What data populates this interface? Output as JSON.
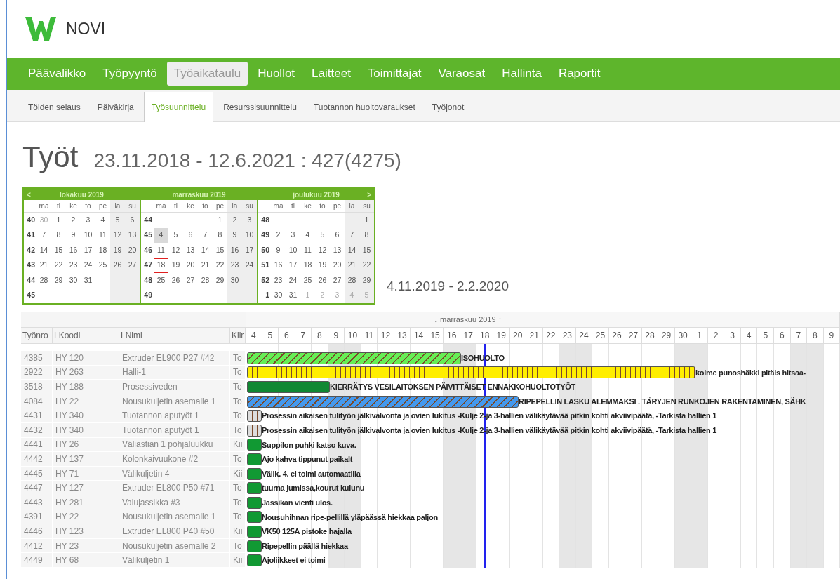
{
  "header": {
    "logo_text": "NOVI"
  },
  "main_nav": [
    {
      "label": "Päävalikko",
      "selected": false
    },
    {
      "label": "Työpyyntö",
      "selected": false
    },
    {
      "label": "Työaikataulu",
      "selected": true
    },
    {
      "label": "Huollot",
      "selected": false
    },
    {
      "label": "Laitteet",
      "selected": false
    },
    {
      "label": "Toimittajat",
      "selected": false
    },
    {
      "label": "Varaosat",
      "selected": false
    },
    {
      "label": "Hallinta",
      "selected": false
    },
    {
      "label": "Raportit",
      "selected": false
    }
  ],
  "sub_nav": [
    {
      "label": "Töiden selaus",
      "selected": false
    },
    {
      "label": "Päiväkirja",
      "selected": false
    },
    {
      "label": "Työsuunnittelu",
      "selected": true
    },
    {
      "label": "Resurssisuunnittelu",
      "selected": false
    },
    {
      "label": "Tuotannon huoltovaraukset",
      "selected": false
    },
    {
      "label": "Työjonot",
      "selected": false
    }
  ],
  "page_title": {
    "title": "Työt",
    "range": "23.11.2018 - 12.6.2021 : 427(4275)"
  },
  "calendar": {
    "prev": "<",
    "next": ">",
    "months": [
      {
        "title": "lokakuu 2019",
        "weekdays": [
          "ma",
          "ti",
          "ke",
          "to",
          "pe",
          "la",
          "su"
        ],
        "weeks": [
          {
            "week": "40",
            "days": [
              {
                "kind": "day",
                "t": "30",
                "muted": true,
                "selected": false,
                "today": false
              },
              {
                "kind": "day",
                "t": "1",
                "muted": false,
                "selected": false,
                "today": false
              },
              {
                "kind": "day",
                "t": "2",
                "muted": false,
                "selected": false,
                "today": false
              },
              {
                "kind": "day",
                "t": "3",
                "muted": false,
                "selected": false,
                "today": false
              },
              {
                "kind": "day",
                "t": "4",
                "muted": false,
                "selected": false,
                "today": false
              },
              {
                "kind": "day",
                "t": "5",
                "muted": false,
                "selected": false,
                "today": false
              },
              {
                "kind": "day",
                "t": "6",
                "muted": false,
                "selected": false,
                "today": false
              }
            ]
          },
          {
            "week": "41",
            "days": [
              {
                "kind": "day",
                "t": "7",
                "muted": false,
                "selected": false,
                "today": false
              },
              {
                "kind": "day",
                "t": "8",
                "muted": false,
                "selected": false,
                "today": false
              },
              {
                "kind": "day",
                "t": "9",
                "muted": false,
                "selected": false,
                "today": false
              },
              {
                "kind": "day",
                "t": "10",
                "muted": false,
                "selected": false,
                "today": false
              },
              {
                "kind": "day",
                "t": "11",
                "muted": false,
                "selected": false,
                "today": false
              },
              {
                "kind": "day",
                "t": "12",
                "muted": false,
                "selected": false,
                "today": false
              },
              {
                "kind": "day",
                "t": "13",
                "muted": false,
                "selected": false,
                "today": false
              }
            ]
          },
          {
            "week": "42",
            "days": [
              {
                "kind": "day",
                "t": "14",
                "muted": false,
                "selected": false,
                "today": false
              },
              {
                "kind": "day",
                "t": "15",
                "muted": false,
                "selected": false,
                "today": false
              },
              {
                "kind": "day",
                "t": "16",
                "muted": false,
                "selected": false,
                "today": false
              },
              {
                "kind": "day",
                "t": "17",
                "muted": false,
                "selected": false,
                "today": false
              },
              {
                "kind": "day",
                "t": "18",
                "muted": false,
                "selected": false,
                "today": false
              },
              {
                "kind": "day",
                "t": "19",
                "muted": false,
                "selected": false,
                "today": false
              },
              {
                "kind": "day",
                "t": "20",
                "muted": false,
                "selected": false,
                "today": false
              }
            ]
          },
          {
            "week": "43",
            "days": [
              {
                "kind": "day",
                "t": "21",
                "muted": false,
                "selected": false,
                "today": false
              },
              {
                "kind": "day",
                "t": "22",
                "muted": false,
                "selected": false,
                "today": false
              },
              {
                "kind": "day",
                "t": "23",
                "muted": false,
                "selected": false,
                "today": false
              },
              {
                "kind": "day",
                "t": "24",
                "muted": false,
                "selected": false,
                "today": false
              },
              {
                "kind": "day",
                "t": "25",
                "muted": false,
                "selected": false,
                "today": false
              },
              {
                "kind": "day",
                "t": "26",
                "muted": false,
                "selected": false,
                "today": false
              },
              {
                "kind": "day",
                "t": "27",
                "muted": false,
                "selected": false,
                "today": false
              }
            ]
          },
          {
            "week": "44",
            "days": [
              {
                "kind": "day",
                "t": "28",
                "muted": false,
                "selected": false,
                "today": false
              },
              {
                "kind": "day",
                "t": "29",
                "muted": false,
                "selected": false,
                "today": false
              },
              {
                "kind": "day",
                "t": "30",
                "muted": false,
                "selected": false,
                "today": false
              },
              {
                "kind": "day",
                "t": "31",
                "muted": false,
                "selected": false,
                "today": false
              },
              {
                "kind": "blank"
              },
              {
                "kind": "blank"
              },
              {
                "kind": "blank"
              }
            ]
          },
          {
            "week": "45",
            "days": [
              {
                "kind": "blank"
              },
              {
                "kind": "blank"
              },
              {
                "kind": "blank"
              },
              {
                "kind": "blank"
              },
              {
                "kind": "blank"
              },
              {
                "kind": "blank"
              },
              {
                "kind": "blank"
              }
            ]
          }
        ]
      },
      {
        "title": "marraskuu 2019",
        "weekdays": [
          "ma",
          "ti",
          "ke",
          "to",
          "pe",
          "la",
          "su"
        ],
        "weeks": [
          {
            "week": "44",
            "days": [
              {
                "kind": "blank"
              },
              {
                "kind": "blank"
              },
              {
                "kind": "blank"
              },
              {
                "kind": "blank"
              },
              {
                "kind": "day",
                "t": "1",
                "muted": false,
                "selected": false,
                "today": false
              },
              {
                "kind": "day",
                "t": "2",
                "muted": false,
                "selected": false,
                "today": false
              },
              {
                "kind": "day",
                "t": "3",
                "muted": false,
                "selected": false,
                "today": false
              }
            ]
          },
          {
            "week": "45",
            "days": [
              {
                "kind": "day",
                "t": "4",
                "muted": false,
                "selected": true,
                "today": false
              },
              {
                "kind": "day",
                "t": "5",
                "muted": false,
                "selected": false,
                "today": false
              },
              {
                "kind": "day",
                "t": "6",
                "muted": false,
                "selected": false,
                "today": false
              },
              {
                "kind": "day",
                "t": "7",
                "muted": false,
                "selected": false,
                "today": false
              },
              {
                "kind": "day",
                "t": "8",
                "muted": false,
                "selected": false,
                "today": false
              },
              {
                "kind": "day",
                "t": "9",
                "muted": false,
                "selected": false,
                "today": false
              },
              {
                "kind": "day",
                "t": "10",
                "muted": false,
                "selected": false,
                "today": false
              }
            ]
          },
          {
            "week": "46",
            "days": [
              {
                "kind": "day",
                "t": "11",
                "muted": false,
                "selected": false,
                "today": false
              },
              {
                "kind": "day",
                "t": "12",
                "muted": false,
                "selected": false,
                "today": false
              },
              {
                "kind": "day",
                "t": "13",
                "muted": false,
                "selected": false,
                "today": false
              },
              {
                "kind": "day",
                "t": "14",
                "muted": false,
                "selected": false,
                "today": false
              },
              {
                "kind": "day",
                "t": "15",
                "muted": false,
                "selected": false,
                "today": false
              },
              {
                "kind": "day",
                "t": "16",
                "muted": false,
                "selected": false,
                "today": false
              },
              {
                "kind": "day",
                "t": "17",
                "muted": false,
                "selected": false,
                "today": false
              }
            ]
          },
          {
            "week": "47",
            "days": [
              {
                "kind": "day",
                "t": "18",
                "muted": false,
                "selected": false,
                "today": true
              },
              {
                "kind": "day",
                "t": "19",
                "muted": false,
                "selected": false,
                "today": false
              },
              {
                "kind": "day",
                "t": "20",
                "muted": false,
                "selected": false,
                "today": false
              },
              {
                "kind": "day",
                "t": "21",
                "muted": false,
                "selected": false,
                "today": false
              },
              {
                "kind": "day",
                "t": "22",
                "muted": false,
                "selected": false,
                "today": false
              },
              {
                "kind": "day",
                "t": "23",
                "muted": false,
                "selected": false,
                "today": false
              },
              {
                "kind": "day",
                "t": "24",
                "muted": false,
                "selected": false,
                "today": false
              }
            ]
          },
          {
            "week": "48",
            "days": [
              {
                "kind": "day",
                "t": "25",
                "muted": false,
                "selected": false,
                "today": false
              },
              {
                "kind": "day",
                "t": "26",
                "muted": false,
                "selected": false,
                "today": false
              },
              {
                "kind": "day",
                "t": "27",
                "muted": false,
                "selected": false,
                "today": false
              },
              {
                "kind": "day",
                "t": "28",
                "muted": false,
                "selected": false,
                "today": false
              },
              {
                "kind": "day",
                "t": "29",
                "muted": false,
                "selected": false,
                "today": false
              },
              {
                "kind": "day",
                "t": "30",
                "muted": false,
                "selected": false,
                "today": false
              },
              {
                "kind": "blank"
              }
            ]
          },
          {
            "week": "49",
            "days": [
              {
                "kind": "blank"
              },
              {
                "kind": "blank"
              },
              {
                "kind": "blank"
              },
              {
                "kind": "blank"
              },
              {
                "kind": "blank"
              },
              {
                "kind": "blank"
              },
              {
                "kind": "blank"
              }
            ]
          }
        ]
      },
      {
        "title": "joulukuu 2019",
        "weekdays": [
          "ma",
          "ti",
          "ke",
          "to",
          "pe",
          "la",
          "su"
        ],
        "weeks": [
          {
            "week": "48",
            "days": [
              {
                "kind": "blank"
              },
              {
                "kind": "blank"
              },
              {
                "kind": "blank"
              },
              {
                "kind": "blank"
              },
              {
                "kind": "blank"
              },
              {
                "kind": "blank"
              },
              {
                "kind": "day",
                "t": "1",
                "muted": false,
                "selected": false,
                "today": false
              }
            ]
          },
          {
            "week": "49",
            "days": [
              {
                "kind": "day",
                "t": "2",
                "muted": false,
                "selected": false,
                "today": false
              },
              {
                "kind": "day",
                "t": "3",
                "muted": false,
                "selected": false,
                "today": false
              },
              {
                "kind": "day",
                "t": "4",
                "muted": false,
                "selected": false,
                "today": false
              },
              {
                "kind": "day",
                "t": "5",
                "muted": false,
                "selected": false,
                "today": false
              },
              {
                "kind": "day",
                "t": "6",
                "muted": false,
                "selected": false,
                "today": false
              },
              {
                "kind": "day",
                "t": "7",
                "muted": false,
                "selected": false,
                "today": false
              },
              {
                "kind": "day",
                "t": "8",
                "muted": false,
                "selected": false,
                "today": false
              }
            ]
          },
          {
            "week": "50",
            "days": [
              {
                "kind": "day",
                "t": "9",
                "muted": false,
                "selected": false,
                "today": false
              },
              {
                "kind": "day",
                "t": "10",
                "muted": false,
                "selected": false,
                "today": false
              },
              {
                "kind": "day",
                "t": "11",
                "muted": false,
                "selected": false,
                "today": false
              },
              {
                "kind": "day",
                "t": "12",
                "muted": false,
                "selected": false,
                "today": false
              },
              {
                "kind": "day",
                "t": "13",
                "muted": false,
                "selected": false,
                "today": false
              },
              {
                "kind": "day",
                "t": "14",
                "muted": false,
                "selected": false,
                "today": false
              },
              {
                "kind": "day",
                "t": "15",
                "muted": false,
                "selected": false,
                "today": false
              }
            ]
          },
          {
            "week": "51",
            "days": [
              {
                "kind": "day",
                "t": "16",
                "muted": false,
                "selected": false,
                "today": false
              },
              {
                "kind": "day",
                "t": "17",
                "muted": false,
                "selected": false,
                "today": false
              },
              {
                "kind": "day",
                "t": "18",
                "muted": false,
                "selected": false,
                "today": false
              },
              {
                "kind": "day",
                "t": "19",
                "muted": false,
                "selected": false,
                "today": false
              },
              {
                "kind": "day",
                "t": "20",
                "muted": false,
                "selected": false,
                "today": false
              },
              {
                "kind": "day",
                "t": "21",
                "muted": false,
                "selected": false,
                "today": false
              },
              {
                "kind": "day",
                "t": "22",
                "muted": false,
                "selected": false,
                "today": false
              }
            ]
          },
          {
            "week": "52",
            "days": [
              {
                "kind": "day",
                "t": "23",
                "muted": false,
                "selected": false,
                "today": false
              },
              {
                "kind": "day",
                "t": "24",
                "muted": false,
                "selected": false,
                "today": false
              },
              {
                "kind": "day",
                "t": "25",
                "muted": false,
                "selected": false,
                "today": false
              },
              {
                "kind": "day",
                "t": "26",
                "muted": false,
                "selected": false,
                "today": false
              },
              {
                "kind": "day",
                "t": "27",
                "muted": false,
                "selected": false,
                "today": false
              },
              {
                "kind": "day",
                "t": "28",
                "muted": false,
                "selected": false,
                "today": false
              },
              {
                "kind": "day",
                "t": "29",
                "muted": false,
                "selected": false,
                "today": false
              }
            ]
          },
          {
            "week": "1",
            "days": [
              {
                "kind": "day",
                "t": "30",
                "muted": false,
                "selected": false,
                "today": false
              },
              {
                "kind": "day",
                "t": "31",
                "muted": false,
                "selected": false,
                "today": false
              },
              {
                "kind": "day",
                "t": "1",
                "muted": true,
                "selected": false,
                "today": false
              },
              {
                "kind": "day",
                "t": "2",
                "muted": true,
                "selected": false,
                "today": false
              },
              {
                "kind": "day",
                "t": "3",
                "muted": true,
                "selected": false,
                "today": false
              },
              {
                "kind": "day",
                "t": "4",
                "muted": true,
                "selected": false,
                "today": false
              },
              {
                "kind": "day",
                "t": "5",
                "muted": true,
                "selected": false,
                "today": false
              }
            ]
          }
        ]
      }
    ]
  },
  "visible_range": "4.11.2019 - 2.2.2020",
  "gantt": {
    "columns": [
      "Työnro",
      "LKoodi",
      "LNimi",
      "Kiir"
    ],
    "months": [
      {
        "label": "↓ marraskuu 2019 ↑",
        "days": [
          {
            "t": "4",
            "weekend": false,
            "today": false
          },
          {
            "t": "5",
            "weekend": false,
            "today": false
          },
          {
            "t": "6",
            "weekend": false,
            "today": false
          },
          {
            "t": "7",
            "weekend": false,
            "today": false
          },
          {
            "t": "8",
            "weekend": false,
            "today": false
          },
          {
            "t": "9",
            "weekend": true,
            "today": false
          },
          {
            "t": "10",
            "weekend": true,
            "today": false
          },
          {
            "t": "11",
            "weekend": false,
            "today": false
          },
          {
            "t": "12",
            "weekend": false,
            "today": false
          },
          {
            "t": "13",
            "weekend": false,
            "today": false
          },
          {
            "t": "14",
            "weekend": false,
            "today": false
          },
          {
            "t": "15",
            "weekend": false,
            "today": false
          },
          {
            "t": "16",
            "weekend": true,
            "today": false
          },
          {
            "t": "17",
            "weekend": true,
            "today": false
          },
          {
            "t": "18",
            "weekend": false,
            "today": true
          },
          {
            "t": "19",
            "weekend": false,
            "today": false
          },
          {
            "t": "20",
            "weekend": false,
            "today": false
          },
          {
            "t": "21",
            "weekend": false,
            "today": false
          },
          {
            "t": "22",
            "weekend": false,
            "today": false
          },
          {
            "t": "23",
            "weekend": true,
            "today": false
          },
          {
            "t": "24",
            "weekend": true,
            "today": false
          },
          {
            "t": "25",
            "weekend": false,
            "today": false
          },
          {
            "t": "26",
            "weekend": false,
            "today": false
          },
          {
            "t": "27",
            "weekend": false,
            "today": false
          },
          {
            "t": "28",
            "weekend": false,
            "today": false
          },
          {
            "t": "29",
            "weekend": false,
            "today": false
          },
          {
            "t": "30",
            "weekend": true,
            "today": false
          }
        ]
      },
      {
        "days": [
          {
            "t": "1",
            "weekend": true,
            "today": false
          },
          {
            "t": "2",
            "weekend": false,
            "today": false
          },
          {
            "t": "3",
            "weekend": false,
            "today": false
          },
          {
            "t": "4",
            "weekend": false,
            "today": false
          },
          {
            "t": "5",
            "weekend": false,
            "today": false
          },
          {
            "t": "6",
            "weekend": false,
            "today": false
          },
          {
            "t": "7",
            "weekend": true,
            "today": false
          },
          {
            "t": "8",
            "weekend": true,
            "today": false
          },
          {
            "t": "9",
            "weekend": false,
            "today": false
          }
        ]
      }
    ],
    "rows": [
      {
        "cells": [
          "4385",
          "HY 120",
          "Extruder EL900 P27 #42",
          "To"
        ],
        "bar": {
          "kind": "hatched",
          "color": "#66ee55",
          "label": "ISOHUOLTO"
        }
      },
      {
        "cells": [
          "2922",
          "HY 263",
          "Halli-1",
          "To"
        ],
        "bar": {
          "kind": "striped",
          "color": "#ffee00",
          "label": "kolme punoshäkki pitäis hitsaa-"
        }
      },
      {
        "cells": [
          "3518",
          "HY 188",
          "Prosessiveden",
          "To"
        ],
        "bar": {
          "kind": "solid",
          "color": "#118833",
          "label": "KIERRÄTYS VESILAITOKSEN PÄIVITTÄISET ENNAKKOHUOLTOTYÖT"
        }
      },
      {
        "cells": [
          "4084",
          "HY 22",
          "Nousukuljetin asemalle 1",
          "To"
        ],
        "bar": {
          "kind": "hatched",
          "color": "#4499ee",
          "label": "RIPEPELLIN LASKU ALEMMAKSI . TÄRYJEN RUNKOJEN RAKENTAMINEN, SÄHK"
        }
      },
      {
        "cells": [
          "4431",
          "HY 340",
          "Tuotannon aputyöt 1",
          "To"
        ],
        "bar": {
          "kind": "striped",
          "color": "#dddddd",
          "label": "Prosessin aikaisen tulityön jälkivalvonta ja ovien lukitus -Kulje 2-ja 3-hallien välikäytävää pitkin kohti akviivipäätä, -Tarkista hallien 1"
        }
      },
      {
        "cells": [
          "4432",
          "HY 340",
          "Tuotannon aputyöt 1",
          "To"
        ],
        "bar": {
          "kind": "striped",
          "color": "#dddddd",
          "label": "Prosessin aikaisen tulityön jälkivalvonta ja ovien lukitus -Kulje 2-ja 3-hallien välikäytävää pitkin kohti akviivipäätä, -Tarkista hallien 1"
        }
      },
      {
        "cells": [
          "4441",
          "HY 26",
          "Väliastian 1 pohjaluukku",
          "Kii"
        ],
        "bar": {
          "kind": "solid",
          "color": "#119933",
          "label": "Suppilon puhki katso kuva."
        }
      },
      {
        "cells": [
          "4442",
          "HY 137",
          "Kolonkaivuukone #2",
          "To"
        ],
        "bar": {
          "kind": "solid",
          "color": "#119933",
          "label": "Ajo kahva tippunut paikalt"
        }
      },
      {
        "cells": [
          "4445",
          "HY 71",
          "Välikuljetin 4",
          "Kii"
        ],
        "bar": {
          "kind": "solid",
          "color": "#119933",
          "label": "Välik. 4. ei toimi automaatilla"
        }
      },
      {
        "cells": [
          "4447",
          "HY 127",
          "Extruder EL800 P50 #71",
          "To"
        ],
        "bar": {
          "kind": "solid",
          "color": "#119933",
          "label": "tuurna jumissa,kourut kulunu"
        }
      },
      {
        "cells": [
          "4443",
          "HY 281",
          "Valujassikka #3",
          "To"
        ],
        "bar": {
          "kind": "solid",
          "color": "#119933",
          "label": "Jassikan vienti ulos."
        }
      },
      {
        "cells": [
          "4391",
          "HY 22",
          "Nousukuljetin asemalle 1",
          "To"
        ],
        "bar": {
          "kind": "solid",
          "color": "#119933",
          "label": "Nousuhihnan ripe-pellillä yläpäässä hiekkaa paljon"
        }
      },
      {
        "cells": [
          "4446",
          "HY 123",
          "Extruder EL800 P40 #50",
          "Kii"
        ],
        "bar": {
          "kind": "solid",
          "color": "#119933",
          "label": "VK50 125A pistoke hajalla"
        }
      },
      {
        "cells": [
          "4412",
          "HY 23",
          "Nousukuljetin asemalle 2",
          "To"
        ],
        "bar": {
          "kind": "solid",
          "color": "#119933",
          "label": "Ripepellin päällä hiekkaa"
        }
      },
      {
        "cells": [
          "4449",
          "HY 68",
          "Välikuljetin 1",
          "Kii"
        ],
        "bar": {
          "kind": "solid",
          "color": "#119933",
          "label": "Ajoliikkeet ei toimi"
        }
      }
    ]
  }
}
